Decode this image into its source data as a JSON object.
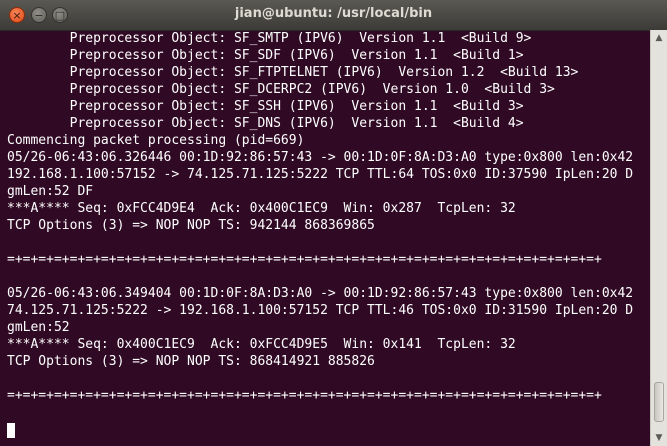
{
  "window": {
    "title": "jian@ubuntu: /usr/local/bin",
    "close_glyph": "×",
    "minimize_glyph": "−",
    "maximize_glyph": "□"
  },
  "terminal": {
    "lines": [
      "        Preprocessor Object: SF_SMTP (IPV6)  Version 1.1  <Build 9>",
      "        Preprocessor Object: SF_SDF (IPV6)  Version 1.1  <Build 1>",
      "        Preprocessor Object: SF_FTPTELNET (IPV6)  Version 1.2  <Build 13>",
      "        Preprocessor Object: SF_DCERPC2 (IPV6)  Version 1.0  <Build 3>",
      "        Preprocessor Object: SF_SSH (IPV6)  Version 1.1  <Build 3>",
      "        Preprocessor Object: SF_DNS (IPV6)  Version 1.1  <Build 4>",
      "Commencing packet processing (pid=669)",
      "05/26-06:43:06.326446 00:1D:92:86:57:43 -> 00:1D:0F:8A:D3:A0 type:0x800 len:0x42",
      "192.168.1.100:57152 -> 74.125.71.125:5222 TCP TTL:64 TOS:0x0 ID:37590 IpLen:20 D",
      "gmLen:52 DF",
      "***A**** Seq: 0xFCC4D9E4  Ack: 0x400C1EC9  Win: 0x287  TcpLen: 32",
      "TCP Options (3) => NOP NOP TS: 942144 868369865",
      "",
      "=+=+=+=+=+=+=+=+=+=+=+=+=+=+=+=+=+=+=+=+=+=+=+=+=+=+=+=+=+=+=+=+=+=+=+=+=+=+",
      "",
      "05/26-06:43:06.349404 00:1D:0F:8A:D3:A0 -> 00:1D:92:86:57:43 type:0x800 len:0x42",
      "74.125.71.125:5222 -> 192.168.1.100:57152 TCP TTL:46 TOS:0x0 ID:31590 IpLen:20 D",
      "gmLen:52",
      "***A**** Seq: 0x400C1EC9  Ack: 0xFCC4D9E5  Win: 0x141  TcpLen: 32",
      "TCP Options (3) => NOP NOP TS: 868414921 885826",
      "",
      "=+=+=+=+=+=+=+=+=+=+=+=+=+=+=+=+=+=+=+=+=+=+=+=+=+=+=+=+=+=+=+=+=+=+=+=+=+=+",
      "",
      ""
    ]
  },
  "colors": {
    "terminal_bg": "#300a24",
    "terminal_fg": "#ffffff",
    "close_button": "#df4a16"
  }
}
